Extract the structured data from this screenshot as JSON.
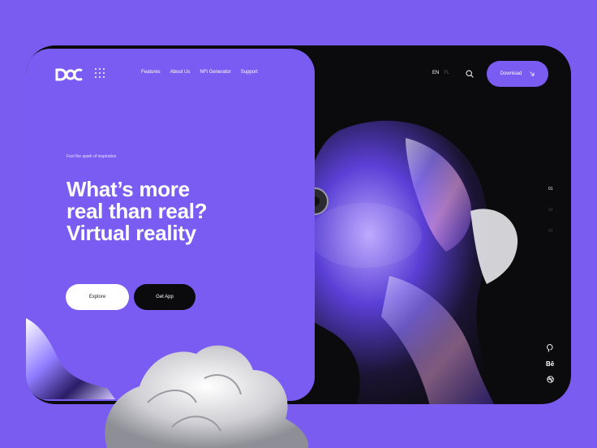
{
  "header": {
    "logo_text": "DOC",
    "nav": [
      "Features",
      "About Us",
      "NFt Generator",
      "Support"
    ],
    "lang_active": "EN",
    "lang_other": "FL",
    "download_label": "Download"
  },
  "hero": {
    "tagline": "Feel the spark of inspiration",
    "headline": [
      "What’s more",
      "real than real?",
      "Virtual reality"
    ],
    "explore_label": "Explore",
    "getapp_label": "Get App"
  },
  "pager": [
    "01",
    "02",
    "03"
  ],
  "social": [
    "pinterest-icon",
    "behance-icon",
    "dribbble-icon"
  ],
  "colors": {
    "accent": "#7b5cf2",
    "dark": "#0b0b0e",
    "background": "#7a5cf0"
  }
}
